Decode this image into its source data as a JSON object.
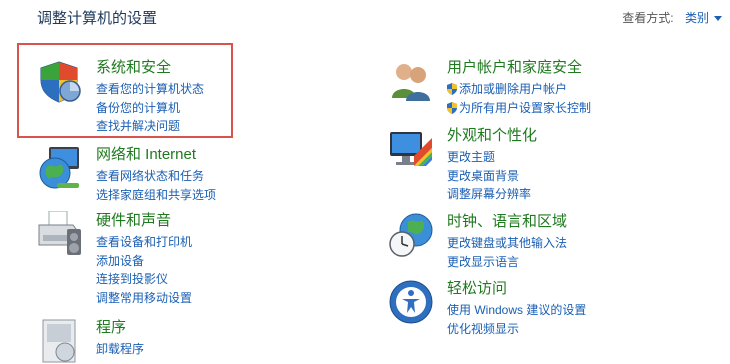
{
  "header": {
    "title": "调整计算机的设置",
    "view_by_label": "查看方式:",
    "view_by_value": "类别"
  },
  "categories": [
    {
      "title": "系统和安全",
      "icon": "shield-security-icon",
      "links": [
        "查看您的计算机状态",
        "备份您的计算机",
        "查找并解决问题"
      ]
    },
    {
      "title": "网络和 Internet",
      "icon": "network-globe-icon",
      "links": [
        "查看网络状态和任务",
        "选择家庭组和共享选项"
      ]
    },
    {
      "title": "硬件和声音",
      "icon": "printer-icon",
      "links": [
        "查看设备和打印机",
        "添加设备",
        "连接到投影仪",
        "调整常用移动设置"
      ]
    },
    {
      "title": "程序",
      "icon": "programs-icon",
      "links": [
        "卸载程序"
      ]
    },
    {
      "title": "用户帐户和家庭安全",
      "icon": "users-icon",
      "links": [
        "添加或删除用户帐户",
        "为所有用户设置家长控制"
      ]
    },
    {
      "title": "外观和个性化",
      "icon": "monitor-palette-icon",
      "links": [
        "更改主题",
        "更改桌面背景",
        "调整屏幕分辨率"
      ]
    },
    {
      "title": "时钟、语言和区域",
      "icon": "clock-globe-icon",
      "links": [
        "更改键盘或其他输入法",
        "更改显示语言"
      ]
    },
    {
      "title": "轻松访问",
      "icon": "ease-of-access-icon",
      "links": [
        "使用 Windows 建议的设置",
        "优化视频显示"
      ]
    }
  ],
  "colors": {
    "title_green": "#1f7a1f",
    "link_blue": "#1a5fb4",
    "highlight_red": "#d9534f"
  }
}
